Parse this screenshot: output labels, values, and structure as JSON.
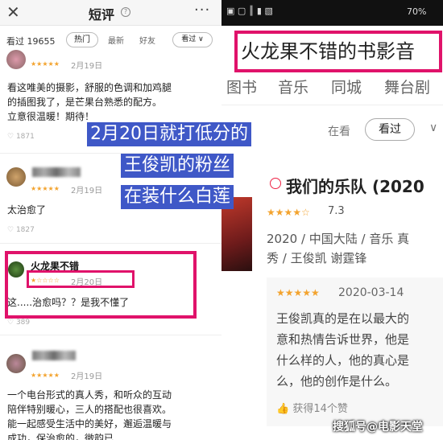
{
  "left": {
    "close_icon": "close-icon",
    "title": "短评",
    "help_mark": "?",
    "more": "···",
    "seen_label": "看过 19655",
    "tabs": [
      "热门",
      "最新",
      "好友"
    ],
    "sort_label": "看过 ∨",
    "reviews": [
      {
        "stars": "★★★★★",
        "date": "2月19日",
        "text": [
          "看这唯美的摄影，舒服的色调和加鸡腿",
          "的插图我了，是芒果台熟悉的配方。",
          "立意很温暖！期待！"
        ],
        "likes": "1871"
      },
      {
        "stars": "★★★★★",
        "date": "2月19日",
        "text": [
          "太治愈了"
        ],
        "likes": "1827"
      },
      {
        "name": "火龙果不错",
        "stars": "★☆☆☆☆",
        "date": "2月20日",
        "text": [
          "这.....治愈吗？？是我不懂了"
        ],
        "likes": "389"
      },
      {
        "stars": "★★★★★",
        "date": "2月19日",
        "text": [
          "一个电台形式的真人秀，和听众的互动",
          "陪伴特别暖心，三人的搭配也很喜欢。",
          "能一起感受生活中的美好，邂逅温暖与",
          "成功，保治愈的，微韵已..."
        ]
      }
    ]
  },
  "right": {
    "status_icons": "▣ ▢ ║ ▮ ▧",
    "battery": "70%",
    "title": "火龙果不错的书影音",
    "categories": [
      "图书",
      "音乐",
      "同城",
      "舞台剧"
    ],
    "filters": {
      "in_progress": "在看",
      "seen": "看过",
      "extra": "∨"
    },
    "movie": {
      "title": "我们的乐队 (2020",
      "stars": "★★★★☆",
      "score": "7.3",
      "meta": [
        "2020 / 中国大陆 / 音乐 真",
        "秀 / 王俊凯 谢霆锋"
      ]
    },
    "review": {
      "stars": "★★★★★",
      "date": "2020-03-14",
      "text": [
        "王俊凯真的是在以最大的",
        "意和热情告诉世界，他是",
        "什么样的人，他的真心是",
        "么，他的创作是什么。"
      ],
      "likes": "获得14个赞"
    },
    "watermark": "搜狐号@电影天堂"
  },
  "overlay": [
    "2月20日就打低分的",
    "王俊凯的粉丝",
    "在装什么白莲"
  ],
  "colors": {
    "highlight": "#e0126a",
    "overlay_bg": "#3f58c7",
    "star": "#f3a32e"
  }
}
